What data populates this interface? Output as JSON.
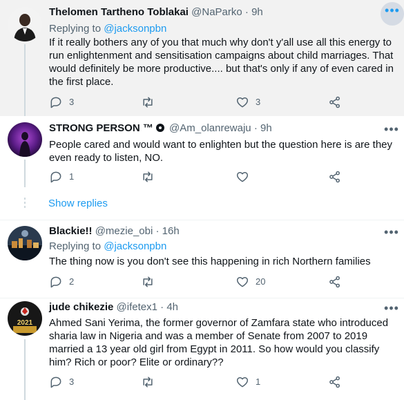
{
  "tweets": [
    {
      "name": "Thelomen Tartheno Toblakai",
      "handle": "@NaParko",
      "time": "9h",
      "replying_label": "Replying to",
      "replying_to": "@jacksonpbn",
      "text": "If it really bothers any of you that much why don't y'all use all this energy to run enlightenment and sensitisation campaigns about child marriages. That would definitely be more productive.... but that's only if any of even cared in the first place.",
      "replies": "3",
      "retweets": "",
      "likes": "3"
    },
    {
      "name": "STRONG PERSON ™",
      "handle": "@Am_olanrewaju",
      "time": "9h",
      "text": "People cared and would want to enlighten but the question here is are they even ready to listen, NO.",
      "replies": "1",
      "retweets": "",
      "likes": ""
    },
    {
      "name": "Blackie!!",
      "handle": "@mezie_obi",
      "time": "16h",
      "replying_label": "Replying to",
      "replying_to": "@jacksonpbn",
      "text": "The thing now is you don't see this happening in rich Northern families",
      "replies": "2",
      "retweets": "",
      "likes": "20"
    },
    {
      "name": "jude chikezie",
      "handle": "@ifetex1",
      "time": "4h",
      "text": "Ahmed Sani Yerima, the former governor of Zamfara state who introduced sharia law in Nigeria and was a member of Senate from 2007 to 2019 married a 13 year old girl from Egypt in 2011. So how would you classify him? Rich or poor? Elite or ordinary??",
      "replies": "3",
      "retweets": "",
      "likes": "1"
    }
  ],
  "show_replies": "Show replies",
  "separator_dot": "·",
  "more_glyph": "•••",
  "avatar4_badge": "2021",
  "icons": {
    "reply": "reply-icon",
    "retweet": "retweet-icon",
    "like": "heart-icon",
    "share": "share-icon",
    "more": "more-icon",
    "verified": "verified-icon"
  },
  "colors": {
    "accent": "#1d9bf0",
    "muted": "#536471",
    "highlight_bg": "#f2f2f2"
  }
}
